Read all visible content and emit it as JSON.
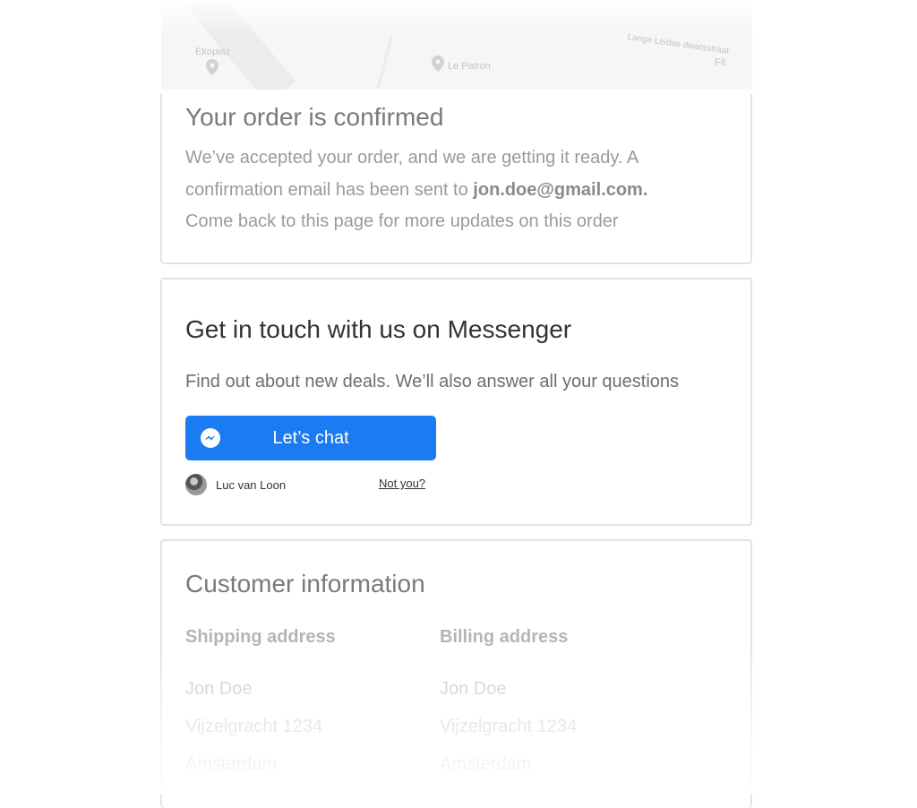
{
  "map": {
    "labels": [
      "Ekopiaz",
      "Le Patron",
      "Fit",
      "Lange Leidse dwarsstraat"
    ]
  },
  "order_confirmed": {
    "title": "Your order is confirmed",
    "line1": "We’ve accepted your order, and we are getting it ready. A",
    "line2_prefix": "confirmation email has been sent to ",
    "email": "jon.doe@gmail.com.",
    "line3": "Come back to this page for more updates on this order"
  },
  "messenger": {
    "title": "Get in touch with us on Messenger",
    "subtitle": "Find out about new deals. We’ll also answer all your questions",
    "button_label": "Let’s chat",
    "button_color": "#1a7bf2",
    "user_name": "Luc van Loon",
    "not_you": "Not you?"
  },
  "customer": {
    "title": "Customer information",
    "shipping": {
      "heading": "Shipping address",
      "lines": [
        "Jon Doe",
        "Vijzelgracht 1234",
        "Amsterdam"
      ]
    },
    "billing": {
      "heading": "Billing address",
      "lines": [
        "Jon Doe",
        "Vijzelgracht 1234",
        "Amsterdam"
      ]
    }
  }
}
